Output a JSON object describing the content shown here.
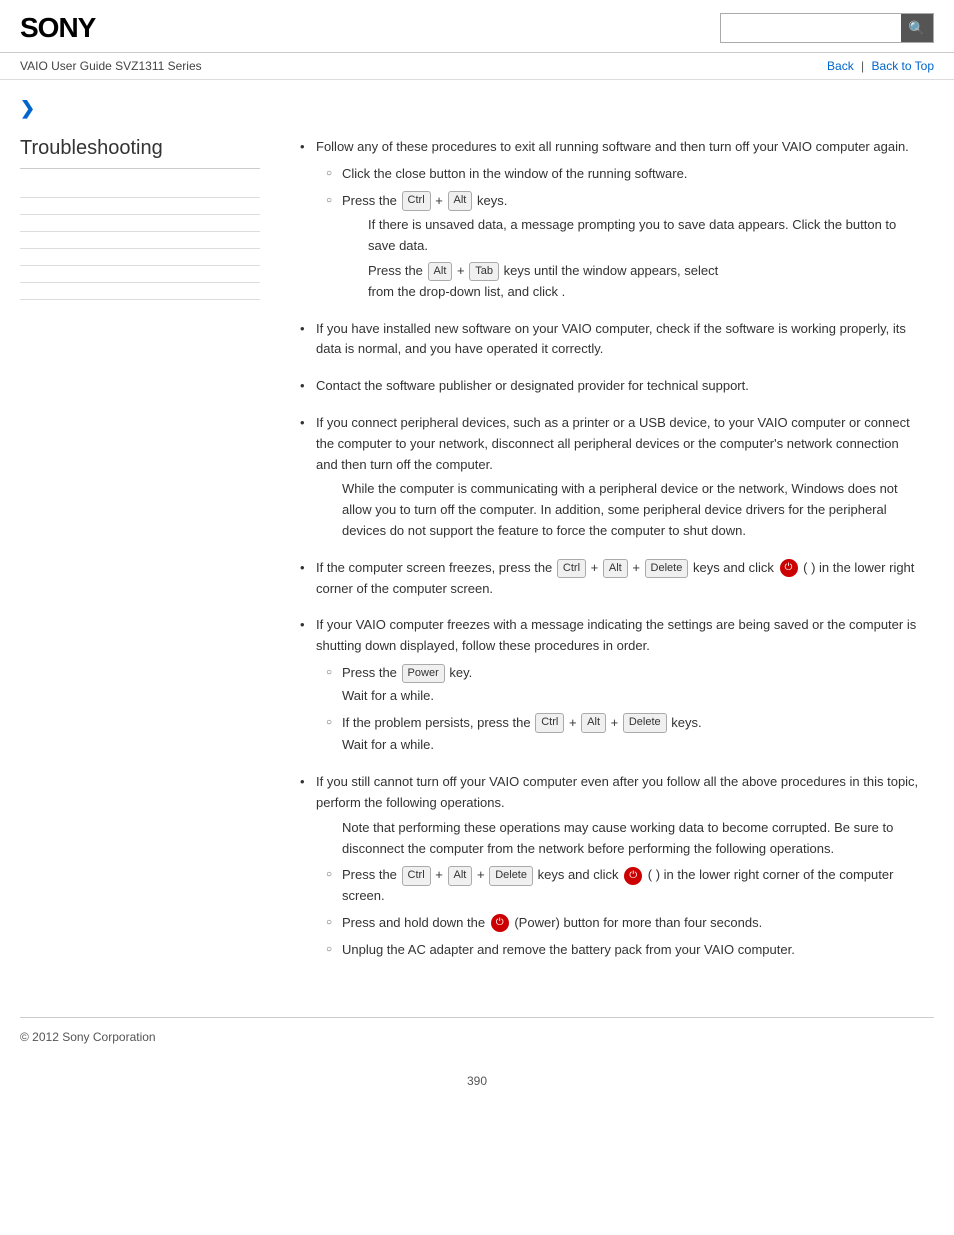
{
  "header": {
    "logo": "SONY",
    "search_placeholder": "",
    "search_icon": "🔍"
  },
  "nav": {
    "guide_text": "VAIO User Guide SVZ1311 Series",
    "back_label": "Back",
    "separator": "|",
    "back_to_top_label": "Back to Top"
  },
  "breadcrumb": {
    "arrow": "❯"
  },
  "sidebar": {
    "title": "Troubleshooting",
    "items": [
      {
        "label": ""
      },
      {
        "label": ""
      },
      {
        "label": ""
      },
      {
        "label": ""
      },
      {
        "label": ""
      },
      {
        "label": ""
      },
      {
        "label": ""
      }
    ]
  },
  "content": {
    "bullet1": "Follow any of these procedures to exit all running software and then turn off your VAIO computer again.",
    "bullet1_sub1": "Click the close button in the window of the running software.",
    "bullet1_sub2_prefix": "Press the",
    "bullet1_sub2_plus": "+",
    "bullet1_sub2_suffix": "keys.",
    "bullet1_sub2_note": "If there is unsaved data, a message prompting you to save data appears. Click the button to save data.",
    "bullet1_sub2_indent1": "Press the",
    "bullet1_sub2_indent1_plus": "+",
    "bullet1_sub2_indent1_keys": "keys until the",
    "bullet1_sub2_indent1_window": "window appears, select",
    "bullet1_sub2_indent1_from": "from the drop-down list, and click",
    "bullet1_sub2_indent1_period": ".",
    "bullet2": "If you have installed new software on your VAIO computer, check if the software is working properly, its data is normal, and you have operated it correctly.",
    "bullet3": "Contact the software publisher or designated provider for technical support.",
    "bullet4": "If you connect peripheral devices, such as a printer or a USB device, to your VAIO computer or connect the computer to your network, disconnect all peripheral devices or the computer's network connection and then turn off the computer.",
    "bullet4_note": "While the computer is communicating with a peripheral device or the network, Windows does not allow you to turn off the computer. In addition, some peripheral device drivers for the peripheral devices do not support the feature to force the computer to shut down.",
    "bullet5_prefix": "If the computer screen freezes, press the",
    "bullet5_keys": "+    +",
    "bullet5_keys_suffix": "keys and click",
    "bullet5_suffix": "( ) in the lower right corner of the computer screen.",
    "bullet6": "If your VAIO computer freezes with a message indicating the settings are being saved or the computer is shutting down displayed, follow these procedures in order.",
    "bullet6_sub1_prefix": "Press the",
    "bullet6_sub1_key": "key.",
    "bullet6_sub1_note": "Wait for a while.",
    "bullet6_sub2_prefix": "If the problem persists, press the",
    "bullet6_sub2_keys": "+    +",
    "bullet6_sub2_suffix": "keys.",
    "bullet6_sub2_note": "Wait for a while.",
    "bullet7": "If you still cannot turn off your VAIO computer even after you follow all the above procedures in this topic, perform the following operations.",
    "bullet7_note": "Note that performing these operations may cause working data to become corrupted. Be sure to disconnect the computer from the network before performing the following operations.",
    "bullet7_sub1_prefix": "Press the",
    "bullet7_sub1_keys": "+    +",
    "bullet7_sub1_keys_suffix": "keys and click",
    "bullet7_sub1_suffix": "( ) in the lower right corner of the computer screen.",
    "bullet7_sub2": "Press and hold down the  (Power) button for more than four seconds.",
    "bullet7_sub3": "Unplug the AC adapter and remove the battery pack from your VAIO computer."
  },
  "footer": {
    "copyright": "© 2012 Sony Corporation"
  },
  "page_number": "390"
}
